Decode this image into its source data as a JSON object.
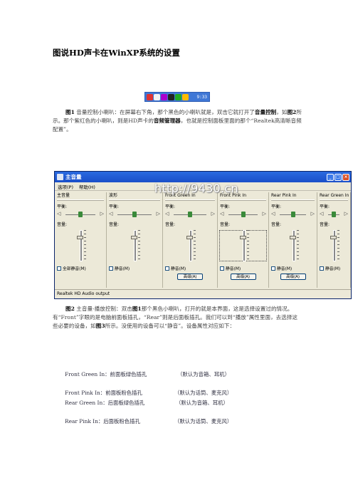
{
  "doc": {
    "title": "图说HD声卡在WinXP系统的设置",
    "tray_clock": "9:33",
    "p1": {
      "fig": "图1",
      "a": " 音量控制小喇叭：在屏幕右下角，那个黑色的小喇叭就是，双击它就打开了",
      "b1": "音量控制",
      "c": "，如",
      "fig2": "图2",
      "d": "所示。那个紫红色的小喇叭，则是HD声卡的",
      "b2": "音频管理器",
      "e": "，也就是控制面板里面的那个“Realtek高清晰音频配置”。"
    },
    "p2": {
      "fig": "图2",
      "a": " 主音量-播放控制：双击",
      "fig1": "图1",
      "b": "那个黑色小喇叭，打开的就是本界面，这是选择设置过的情况。有“Front”字眼的是电脑前面板插孔，“Rear”则是后面板插孔。我们可以到“播放”属性里面，去选择这些必要的设备，如",
      "fig3": "图3",
      "c": "所示。没使用的设备可以“静音”。设备属性对应如下："
    },
    "list": [
      {
        "name": "Front Green In：前面板绿色插孔",
        "note": "（默认为音箱、耳机）"
      },
      {
        "name": "Front Pink In：前面板粉色插孔",
        "note": "（默认为话筒、麦克风）"
      },
      {
        "name": "Rear Green In：后面板绿色插孔",
        "note": "（默认为音箱、耳机）"
      },
      {
        "name": "Rear Pink In：后面板粉色插孔",
        "note": "（默认为话筒、麦克风）"
      }
    ]
  },
  "mixer": {
    "window_title": "主音量",
    "menu": [
      "选项(P)",
      "帮助(H)"
    ],
    "watermark": "http://9430.cn",
    "balance_label": "平衡:",
    "volume_label": "音量:",
    "mute_all": "全部静音(M)",
    "mute": "静音(M)",
    "advanced": "高级(A)",
    "status": "Realtek HD Audio output",
    "columns": [
      {
        "name": "主音量",
        "volume": 0.8,
        "checkbox": "mute_all",
        "advanced": false
      },
      {
        "name": "波形",
        "volume": 0.8,
        "checkbox": "mute",
        "advanced": false
      },
      {
        "name": "Front Green In",
        "volume": 0.8,
        "checkbox": "mute",
        "advanced": true
      },
      {
        "name": "Front Pink In",
        "volume": 0.8,
        "checkbox": "mute",
        "advanced": true,
        "focused": true
      },
      {
        "name": "Rear Pink In",
        "volume": 0.8,
        "checkbox": "mute",
        "advanced": true
      },
      {
        "name": "Rear Green In",
        "volume": 0.8,
        "checkbox": "mute",
        "advanced": false
      }
    ]
  },
  "colors": {
    "title_bar": "#1b4fc9",
    "window_bg": "#ece9d8",
    "tray": "#3f77d6"
  }
}
